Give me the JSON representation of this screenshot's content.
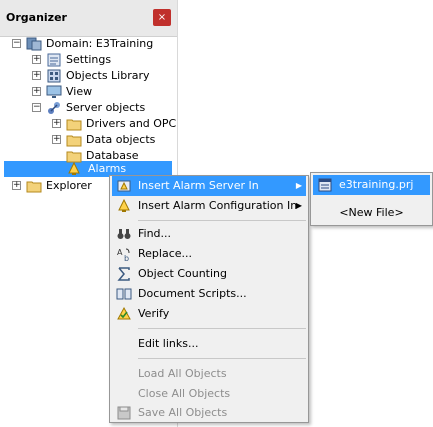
{
  "organizer": {
    "title": "Organizer",
    "close_glyph": "×",
    "tree": [
      {
        "label": "Domain: E3Training",
        "icon": "domain-icon",
        "expander": "−"
      },
      {
        "label": "Settings",
        "icon": "settings-icon",
        "expander": "+"
      },
      {
        "label": "Objects Library",
        "icon": "objects-library-icon",
        "expander": "+"
      },
      {
        "label": "View",
        "icon": "view-icon",
        "expander": "+"
      },
      {
        "label": "Server objects",
        "icon": "server-objects-icon",
        "expander": "−"
      },
      {
        "label": "Drivers and OPC",
        "icon": "folder-icon",
        "expander": "+"
      },
      {
        "label": "Data objects",
        "icon": "folder-icon",
        "expander": "+"
      },
      {
        "label": "Database",
        "icon": "folder-icon",
        "expander": ""
      },
      {
        "label": "Alarms",
        "icon": "alarm-icon",
        "expander": ""
      },
      {
        "label": "Explorer",
        "icon": "folder-icon",
        "expander": "+"
      }
    ]
  },
  "context_menu": {
    "items": [
      {
        "label": "Insert Alarm Server In",
        "icon": "alarm-server-icon",
        "has_submenu": true
      },
      {
        "label": "Insert Alarm Configuration In",
        "icon": "alarm-config-icon",
        "has_submenu": true
      },
      {
        "label": "Find...",
        "icon": "binoculars-icon"
      },
      {
        "label": "Replace...",
        "icon": "replace-icon"
      },
      {
        "label": "Object Counting",
        "icon": "sigma-icon"
      },
      {
        "label": "Document Scripts...",
        "icon": "book-icon"
      },
      {
        "label": "Verify",
        "icon": "verify-icon"
      },
      {
        "label": "Edit links..."
      },
      {
        "label": "Load All Objects",
        "disabled": true
      },
      {
        "label": "Close All Objects",
        "disabled": true
      },
      {
        "label": "Save All Objects",
        "icon": "save-icon",
        "disabled": true
      }
    ]
  },
  "submenu": {
    "items": [
      {
        "label": "e3training.prj",
        "icon": "project-icon"
      },
      {
        "label": "<New File>"
      }
    ]
  },
  "colors": {
    "selection": "#3399ff",
    "close_button": "#c0302c",
    "menu_background": "#f0f0f0"
  }
}
